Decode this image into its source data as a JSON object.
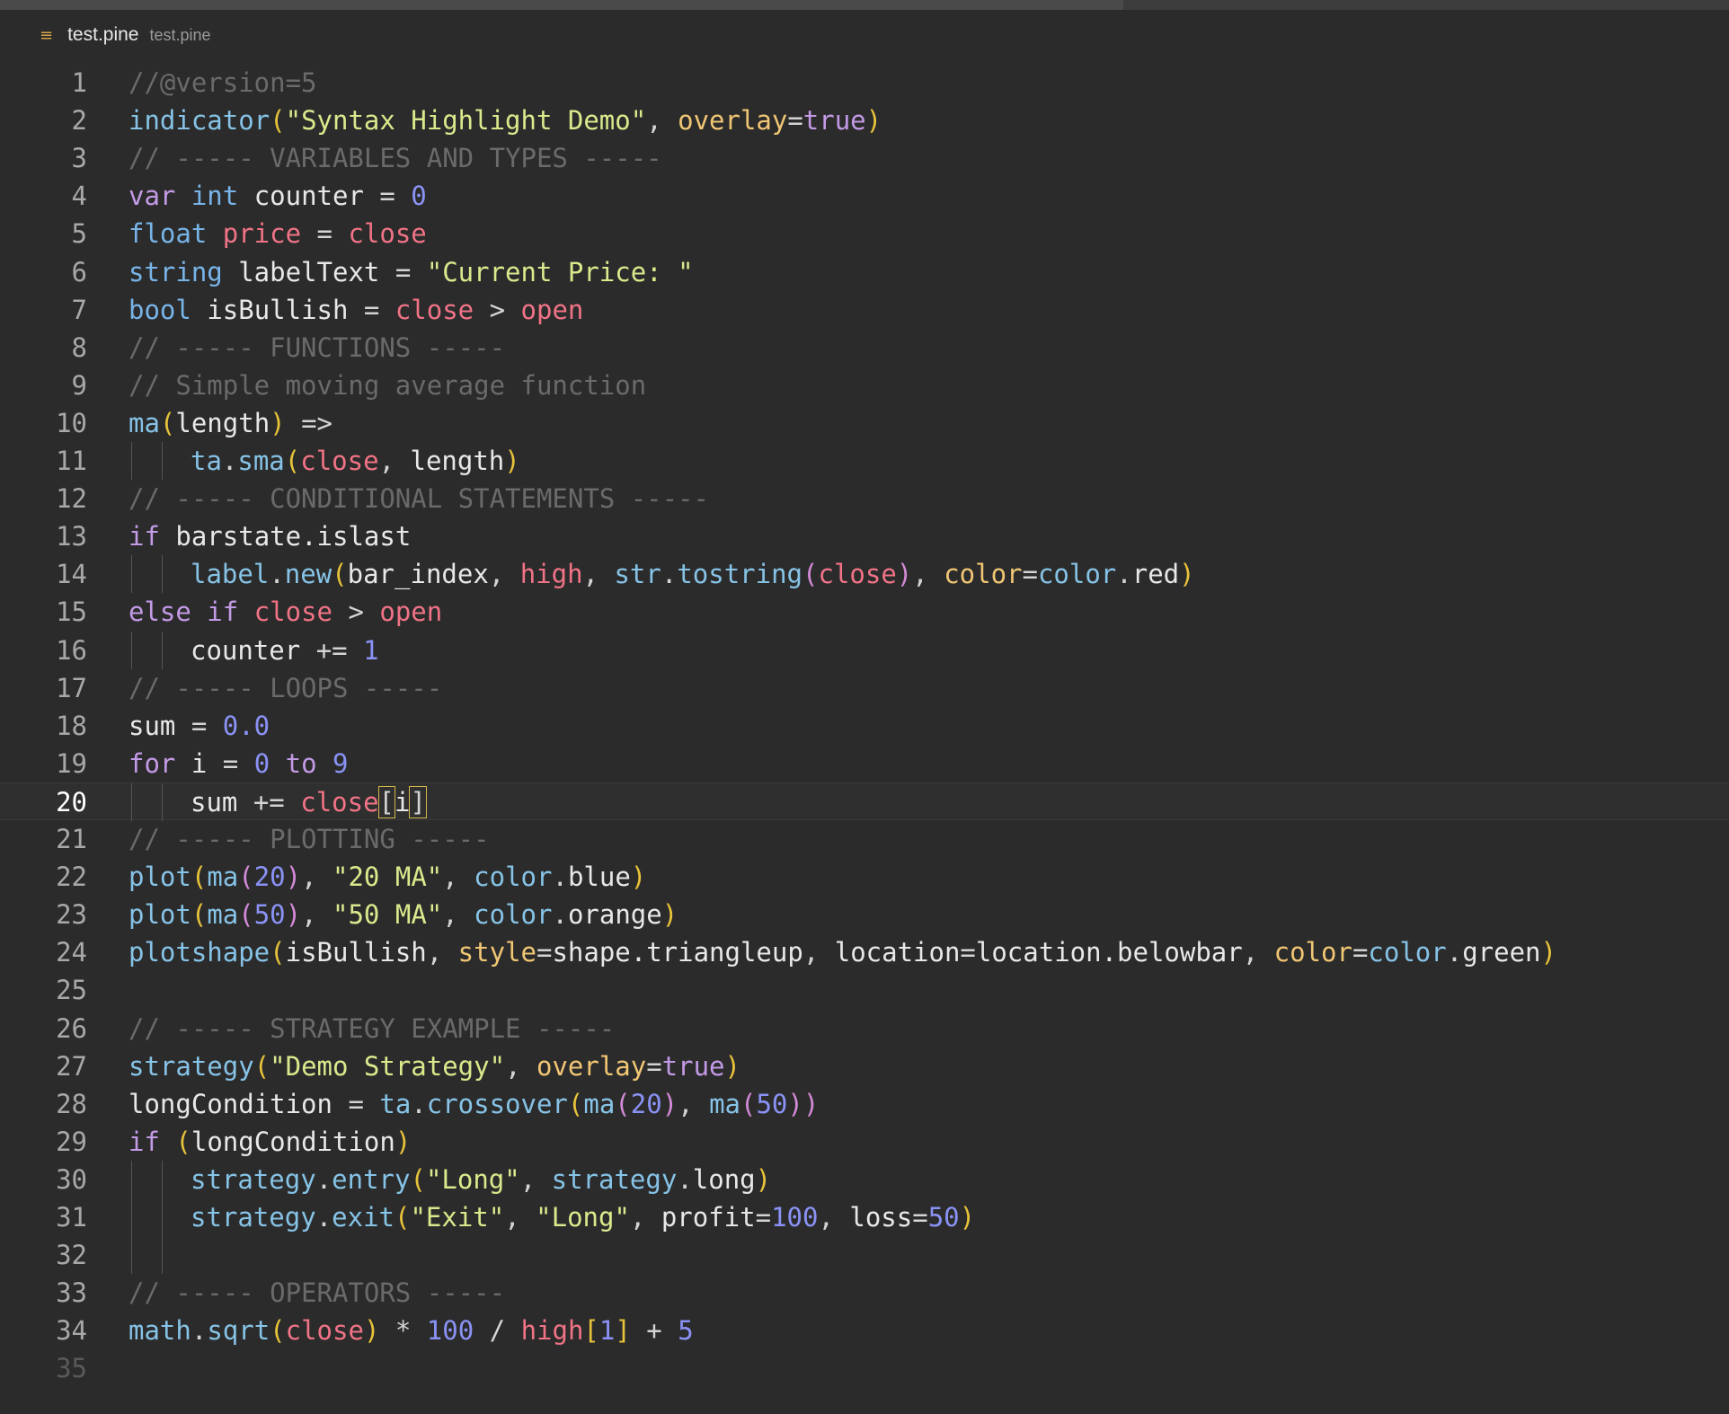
{
  "tab": {
    "file_icon": "file-lines-icon",
    "name": "test.pine",
    "description": "test.pine"
  },
  "editor": {
    "current_line": 20,
    "colors": {
      "background": "#2b2b2b",
      "comment": "#6a6a6a",
      "keyword": "#c39ae6",
      "type": "#78b4e8",
      "string": "#d9ea8c",
      "number": "#8a92f5",
      "variable": "#f07386",
      "param": "#f0c674"
    },
    "lines": [
      {
        "n": "1",
        "t": [
          [
            "cm",
            "//@version=5"
          ]
        ]
      },
      {
        "n": "2",
        "t": [
          [
            "fn",
            "indicator"
          ],
          [
            "br1",
            "("
          ],
          [
            "st",
            "\"Syntax Highlight Demo\""
          ],
          [
            "op",
            ", "
          ],
          [
            "pa",
            "overlay"
          ],
          [
            "op",
            "="
          ],
          [
            "kw",
            "true"
          ],
          [
            "br1",
            ")"
          ]
        ]
      },
      {
        "n": "3",
        "t": [
          [
            "cm",
            "// ----- VARIABLES AND TYPES -----"
          ]
        ]
      },
      {
        "n": "4",
        "t": [
          [
            "kw",
            "var "
          ],
          [
            "ty",
            "int "
          ],
          [
            "pl",
            "counter "
          ],
          [
            "op",
            "= "
          ],
          [
            "nu",
            "0"
          ]
        ]
      },
      {
        "n": "5",
        "t": [
          [
            "ty",
            "float "
          ],
          [
            "va",
            "price "
          ],
          [
            "op",
            "= "
          ],
          [
            "va",
            "close"
          ]
        ]
      },
      {
        "n": "6",
        "t": [
          [
            "ty",
            "string "
          ],
          [
            "pl",
            "labelText "
          ],
          [
            "op",
            "= "
          ],
          [
            "st",
            "\"Current Price: \""
          ]
        ]
      },
      {
        "n": "7",
        "t": [
          [
            "ty",
            "bool "
          ],
          [
            "pl",
            "isBullish "
          ],
          [
            "op",
            "= "
          ],
          [
            "va",
            "close "
          ],
          [
            "op",
            "> "
          ],
          [
            "va",
            "open"
          ]
        ]
      },
      {
        "n": "8",
        "t": [
          [
            "cm",
            "// ----- FUNCTIONS -----"
          ]
        ]
      },
      {
        "n": "9",
        "t": [
          [
            "cm",
            "// Simple moving average function"
          ]
        ]
      },
      {
        "n": "10",
        "t": [
          [
            "fn",
            "ma"
          ],
          [
            "br1",
            "("
          ],
          [
            "pl",
            "length"
          ],
          [
            "br1",
            ")"
          ],
          [
            "op",
            " =>"
          ]
        ]
      },
      {
        "n": "11",
        "g": 1,
        "t": [
          [
            "fn",
            "ta"
          ],
          [
            "op",
            "."
          ],
          [
            "fn",
            "sma"
          ],
          [
            "br1",
            "("
          ],
          [
            "va",
            "close"
          ],
          [
            "op",
            ", "
          ],
          [
            "pl",
            "length"
          ],
          [
            "br1",
            ")"
          ]
        ]
      },
      {
        "n": "12",
        "t": [
          [
            "cm",
            "// ----- CONDITIONAL STATEMENTS -----"
          ]
        ]
      },
      {
        "n": "13",
        "t": [
          [
            "kw",
            "if "
          ],
          [
            "pl",
            "barstate.islast"
          ]
        ]
      },
      {
        "n": "14",
        "g": 1,
        "t": [
          [
            "fn",
            "label"
          ],
          [
            "op",
            "."
          ],
          [
            "fn",
            "new"
          ],
          [
            "br1",
            "("
          ],
          [
            "pl",
            "bar_index"
          ],
          [
            "op",
            ", "
          ],
          [
            "va",
            "high"
          ],
          [
            "op",
            ", "
          ],
          [
            "fn",
            "str"
          ],
          [
            "op",
            "."
          ],
          [
            "fn",
            "tostring"
          ],
          [
            "br2",
            "("
          ],
          [
            "va",
            "close"
          ],
          [
            "br2",
            ")"
          ],
          [
            "op",
            ", "
          ],
          [
            "pa",
            "color"
          ],
          [
            "op",
            "="
          ],
          [
            "fn",
            "color"
          ],
          [
            "op",
            "."
          ],
          [
            "pl",
            "red"
          ],
          [
            "br1",
            ")"
          ]
        ]
      },
      {
        "n": "15",
        "t": [
          [
            "kw",
            "else if "
          ],
          [
            "va",
            "close "
          ],
          [
            "op",
            "> "
          ],
          [
            "va",
            "open"
          ]
        ]
      },
      {
        "n": "16",
        "g": 1,
        "t": [
          [
            "pl",
            "counter "
          ],
          [
            "op",
            "+= "
          ],
          [
            "nu",
            "1"
          ]
        ]
      },
      {
        "n": "17",
        "t": [
          [
            "cm",
            "// ----- LOOPS -----"
          ]
        ]
      },
      {
        "n": "18",
        "t": [
          [
            "pl",
            "sum "
          ],
          [
            "op",
            "= "
          ],
          [
            "nu",
            "0.0"
          ]
        ]
      },
      {
        "n": "19",
        "t": [
          [
            "kw",
            "for "
          ],
          [
            "pl",
            "i "
          ],
          [
            "op",
            "= "
          ],
          [
            "nu",
            "0 "
          ],
          [
            "kw",
            "to "
          ],
          [
            "nu",
            "9"
          ]
        ]
      },
      {
        "n": "20",
        "g": 1,
        "t": [
          [
            "pl",
            "sum "
          ],
          [
            "op",
            "+= "
          ],
          [
            "va",
            "close"
          ],
          [
            "bh",
            "["
          ],
          [
            "pl",
            "i"
          ],
          [
            "bh",
            "]"
          ]
        ]
      },
      {
        "n": "21",
        "t": [
          [
            "cm",
            "// ----- PLOTTING -----"
          ]
        ]
      },
      {
        "n": "22",
        "t": [
          [
            "fn",
            "plot"
          ],
          [
            "br1",
            "("
          ],
          [
            "fn",
            "ma"
          ],
          [
            "br2",
            "("
          ],
          [
            "nu",
            "20"
          ],
          [
            "br2",
            ")"
          ],
          [
            "op",
            ", "
          ],
          [
            "st",
            "\"20 MA\""
          ],
          [
            "op",
            ", "
          ],
          [
            "fn",
            "color"
          ],
          [
            "op",
            "."
          ],
          [
            "pl",
            "blue"
          ],
          [
            "br1",
            ")"
          ]
        ]
      },
      {
        "n": "23",
        "t": [
          [
            "fn",
            "plot"
          ],
          [
            "br1",
            "("
          ],
          [
            "fn",
            "ma"
          ],
          [
            "br2",
            "("
          ],
          [
            "nu",
            "50"
          ],
          [
            "br2",
            ")"
          ],
          [
            "op",
            ", "
          ],
          [
            "st",
            "\"50 MA\""
          ],
          [
            "op",
            ", "
          ],
          [
            "fn",
            "color"
          ],
          [
            "op",
            "."
          ],
          [
            "pl",
            "orange"
          ],
          [
            "br1",
            ")"
          ]
        ]
      },
      {
        "n": "24",
        "t": [
          [
            "fn",
            "plotshape"
          ],
          [
            "br1",
            "("
          ],
          [
            "pl",
            "isBullish"
          ],
          [
            "op",
            ", "
          ],
          [
            "pa",
            "style"
          ],
          [
            "op",
            "="
          ],
          [
            "pl",
            "shape.triangleup"
          ],
          [
            "op",
            ", "
          ],
          [
            "pl",
            "location"
          ],
          [
            "op",
            "="
          ],
          [
            "pl",
            "location.belowbar"
          ],
          [
            "op",
            ", "
          ],
          [
            "pa",
            "color"
          ],
          [
            "op",
            "="
          ],
          [
            "fn",
            "color"
          ],
          [
            "op",
            "."
          ],
          [
            "pl",
            "green"
          ],
          [
            "br1",
            ")"
          ]
        ]
      },
      {
        "n": "25",
        "t": []
      },
      {
        "n": "26",
        "t": [
          [
            "cm",
            "// ----- STRATEGY EXAMPLE -----"
          ]
        ]
      },
      {
        "n": "27",
        "t": [
          [
            "fn",
            "strategy"
          ],
          [
            "br1",
            "("
          ],
          [
            "st",
            "\"Demo Strategy\""
          ],
          [
            "op",
            ", "
          ],
          [
            "pa",
            "overlay"
          ],
          [
            "op",
            "="
          ],
          [
            "kw",
            "true"
          ],
          [
            "br1",
            ")"
          ]
        ]
      },
      {
        "n": "28",
        "t": [
          [
            "pl",
            "longCondition "
          ],
          [
            "op",
            "= "
          ],
          [
            "fn",
            "ta"
          ],
          [
            "op",
            "."
          ],
          [
            "fn",
            "crossover"
          ],
          [
            "br1",
            "("
          ],
          [
            "fn",
            "ma"
          ],
          [
            "br2",
            "("
          ],
          [
            "nu",
            "20"
          ],
          [
            "br2",
            ")"
          ],
          [
            "op",
            ", "
          ],
          [
            "fn",
            "ma"
          ],
          [
            "br2",
            "("
          ],
          [
            "nu",
            "50"
          ],
          [
            "br2",
            "))"
          ]
        ]
      },
      {
        "n": "29",
        "t": [
          [
            "kw",
            "if "
          ],
          [
            "br1",
            "("
          ],
          [
            "pl",
            "longCondition"
          ],
          [
            "br1",
            ")"
          ]
        ]
      },
      {
        "n": "30",
        "g": 1,
        "t": [
          [
            "fn",
            "strategy"
          ],
          [
            "op",
            "."
          ],
          [
            "fn",
            "entry"
          ],
          [
            "br1",
            "("
          ],
          [
            "st",
            "\"Long\""
          ],
          [
            "op",
            ", "
          ],
          [
            "fn",
            "strategy"
          ],
          [
            "op",
            "."
          ],
          [
            "pl",
            "long"
          ],
          [
            "br1",
            ")"
          ]
        ]
      },
      {
        "n": "31",
        "g": 1,
        "t": [
          [
            "fn",
            "strategy"
          ],
          [
            "op",
            "."
          ],
          [
            "fn",
            "exit"
          ],
          [
            "br1",
            "("
          ],
          [
            "st",
            "\"Exit\""
          ],
          [
            "op",
            ", "
          ],
          [
            "st",
            "\"Long\""
          ],
          [
            "op",
            ", "
          ],
          [
            "pl",
            "profit"
          ],
          [
            "op",
            "="
          ],
          [
            "nu",
            "100"
          ],
          [
            "op",
            ", "
          ],
          [
            "pl",
            "loss"
          ],
          [
            "op",
            "="
          ],
          [
            "nu",
            "50"
          ],
          [
            "br1",
            ")"
          ]
        ]
      },
      {
        "n": "32",
        "g": 1,
        "t": []
      },
      {
        "n": "33",
        "t": [
          [
            "cm",
            "// ----- OPERATORS -----"
          ]
        ]
      },
      {
        "n": "34",
        "t": [
          [
            "fn",
            "math"
          ],
          [
            "op",
            "."
          ],
          [
            "fn",
            "sqrt"
          ],
          [
            "br1",
            "("
          ],
          [
            "va",
            "close"
          ],
          [
            "br1",
            ")"
          ],
          [
            "op",
            " * "
          ],
          [
            "nu",
            "100 "
          ],
          [
            "op",
            "/ "
          ],
          [
            "va",
            "high"
          ],
          [
            "br1",
            "["
          ],
          [
            "nu",
            "1"
          ],
          [
            "br1",
            "]"
          ],
          [
            "op",
            " + "
          ],
          [
            "nu",
            "5"
          ]
        ]
      },
      {
        "n": "35",
        "t": []
      }
    ]
  }
}
